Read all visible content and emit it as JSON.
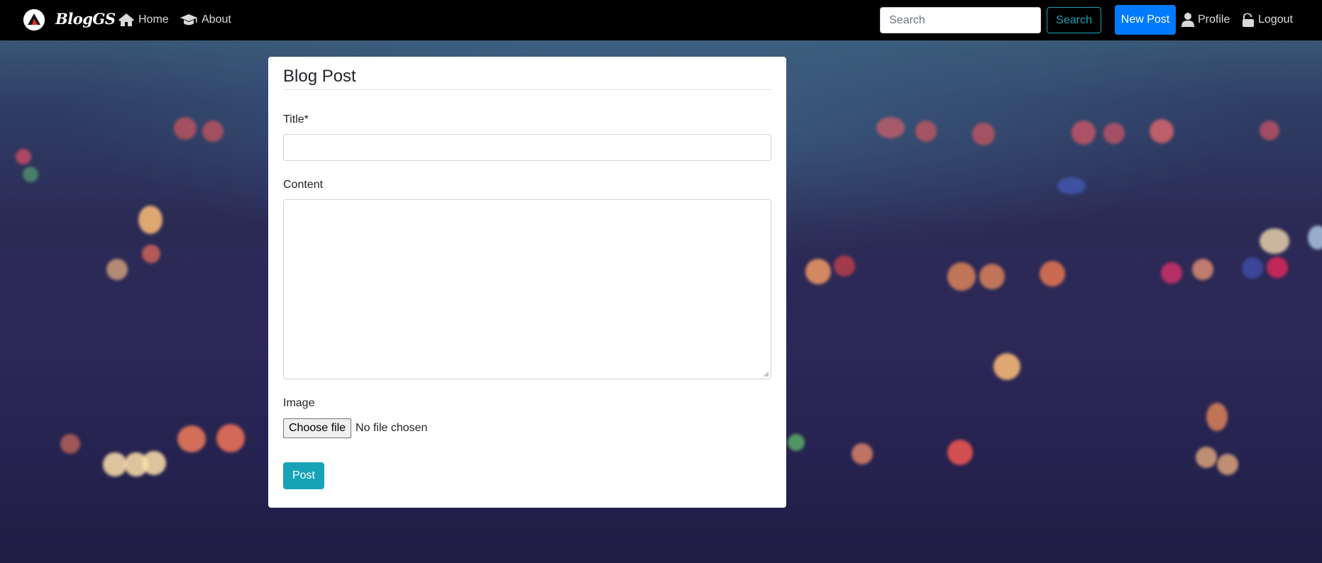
{
  "navbar": {
    "brand": "BlogGS",
    "links": [
      {
        "label": "Home",
        "icon": "home-icon"
      },
      {
        "label": "About",
        "icon": "graduation-cap-icon"
      }
    ],
    "search": {
      "placeholder": "Search",
      "button_label": "Search"
    },
    "new_post_label": "New Post",
    "profile_label": "Profile",
    "logout_label": "Logout"
  },
  "form": {
    "legend": "Blog Post",
    "title_label": "Title*",
    "title_value": "",
    "content_label": "Content",
    "content_value": "",
    "image_label": "Image",
    "file_button_label": "Choose file",
    "file_status": "No file chosen",
    "submit_label": "Post"
  },
  "colors": {
    "navbar_bg": "#000000",
    "primary": "#007bff",
    "info": "#17a2b8",
    "logo_accent": "#e03131"
  }
}
